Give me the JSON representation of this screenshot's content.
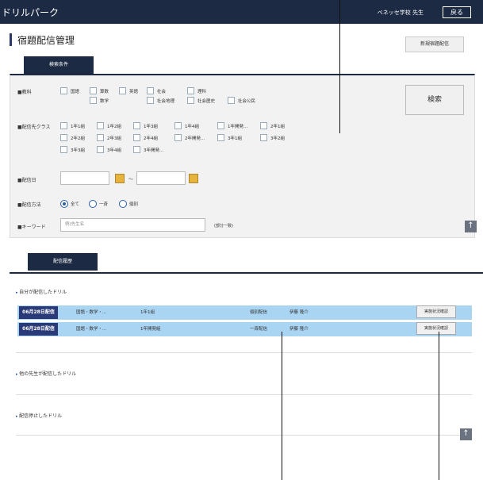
{
  "header": {
    "logo": "ドリルパーク",
    "school": "ベネッセ学校 先生",
    "back_label": "戻る"
  },
  "page": {
    "title": "宿題配信管理",
    "new_button": "新規宿題配信"
  },
  "search": {
    "tab_label": "検索条件",
    "subject_label": "■教科",
    "subjects_row1": [
      "国語",
      "算数",
      "英語",
      "社会",
      "理科"
    ],
    "subjects_row2": [
      "数学",
      "社会地理",
      "社会歴史",
      "社会公民"
    ],
    "class_label": "■配信先クラス",
    "classes_row1": [
      "1年1組",
      "1年2組",
      "1年3組",
      "1年4組",
      "1年開発…",
      "2年1組"
    ],
    "classes_row2": [
      "2年2組",
      "2年3組",
      "2年4組",
      "2年開発…",
      "3年1組",
      "3年2組"
    ],
    "classes_row3": [
      "3年3組",
      "3年4組",
      "3年開発…"
    ],
    "date_label": "■配信日",
    "date_sep": "〜",
    "method_label": "■配信方法",
    "methods": [
      "全て",
      "一斉",
      "個別"
    ],
    "keyword_label": "■キーワード",
    "keyword_placeholder": "例)先生名",
    "keyword_hint": "(部分一致)",
    "search_button": "検索"
  },
  "history": {
    "tab_label": "配信履歴",
    "my_section": "自分が配信したドリル",
    "other_section": "他の先生が配信したドリル",
    "stopped_section": "配信停止したドリル",
    "rows": [
      {
        "date": "06月28日配信",
        "subject": "国語・数学・…",
        "class": "1年1組",
        "method": "個別配信",
        "teacher": "伊藤 隆介",
        "button": "実施状況確認"
      },
      {
        "date": "06月28日配信",
        "subject": "国語・数学・…",
        "class": "1年開発組",
        "method": "一斉配信",
        "teacher": "伊藤 隆介",
        "button": "実施状況確認"
      }
    ]
  },
  "icons": {
    "up": "to-top-icon",
    "calendar": "calendar-icon"
  },
  "colors": {
    "nav": "#1c2a44",
    "row_highlight": "#a9d4f2",
    "date_badge": "#2a3a78",
    "calendar": "#e6b43c"
  }
}
